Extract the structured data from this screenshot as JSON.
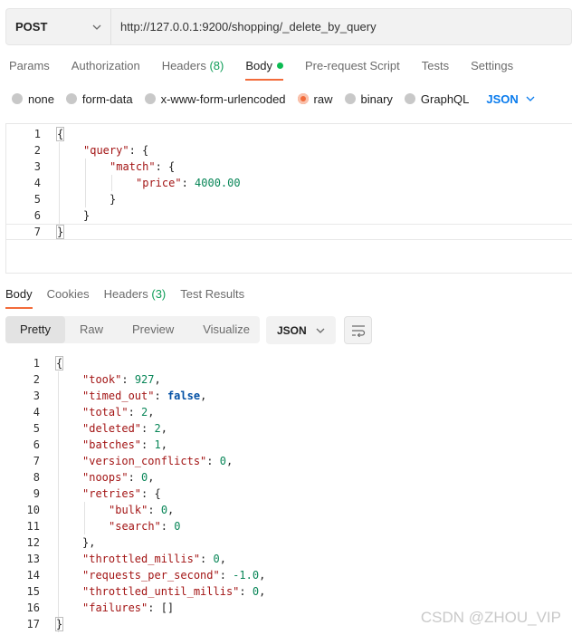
{
  "request": {
    "method": "POST",
    "url": "http://127.0.0.1:9200/shopping/_delete_by_query"
  },
  "request_tabs": {
    "params": "Params",
    "authorization": "Authorization",
    "headers": "Headers",
    "headers_count": "(8)",
    "body": "Body",
    "prerequest": "Pre-request Script",
    "tests": "Tests",
    "settings": "Settings"
  },
  "body_types": {
    "none": "none",
    "form_data": "form-data",
    "urlencoded": "x-www-form-urlencoded",
    "raw": "raw",
    "binary": "binary",
    "graphql": "GraphQL",
    "format": "JSON",
    "selected": "raw"
  },
  "request_body": {
    "line_numbers": [
      "1",
      "2",
      "3",
      "4",
      "5",
      "6",
      "7"
    ],
    "lines": {
      "l1": "{",
      "l2_key": "\"query\"",
      "l2_rest": ": {",
      "l3_key": "\"match\"",
      "l3_rest": ": {",
      "l4_key": "\"price\"",
      "l4_sep": ": ",
      "l4_val": "4000.00",
      "l5": "}",
      "l6": "}",
      "l7": "}"
    }
  },
  "response_tabs": {
    "body": "Body",
    "cookies": "Cookies",
    "headers": "Headers",
    "headers_count": "(3)",
    "test_results": "Test Results"
  },
  "response_toolbar": {
    "pretty": "Pretty",
    "raw": "Raw",
    "preview": "Preview",
    "visualize": "Visualize",
    "format": "JSON"
  },
  "response_body": {
    "line_numbers": [
      "1",
      "2",
      "3",
      "4",
      "5",
      "6",
      "7",
      "8",
      "9",
      "10",
      "11",
      "12",
      "13",
      "14",
      "15",
      "16",
      "17"
    ],
    "lines": {
      "l1": "{",
      "took_k": "\"took\"",
      "took_v": "927",
      "timed_out_k": "\"timed_out\"",
      "timed_out_v": "false",
      "total_k": "\"total\"",
      "total_v": "2",
      "deleted_k": "\"deleted\"",
      "deleted_v": "2",
      "batches_k": "\"batches\"",
      "batches_v": "1",
      "version_conflicts_k": "\"version_conflicts\"",
      "version_conflicts_v": "0",
      "noops_k": "\"noops\"",
      "noops_v": "0",
      "retries_k": "\"retries\"",
      "bulk_k": "\"bulk\"",
      "bulk_v": "0",
      "search_k": "\"search\"",
      "search_v": "0",
      "retries_close": "},",
      "throttled_millis_k": "\"throttled_millis\"",
      "throttled_millis_v": "0",
      "rps_k": "\"requests_per_second\"",
      "rps_v": "-1.0",
      "throttled_until_k": "\"throttled_until_millis\"",
      "throttled_until_v": "0",
      "failures_k": "\"failures\"",
      "failures_v": "[]",
      "l17": "}"
    }
  },
  "watermark": "CSDN @ZHOU_VIP",
  "colors": {
    "accent": "#f26b3a",
    "json_link": "#097bed",
    "key": "#a31515",
    "number": "#098658",
    "boolean": "#0451a5",
    "count_green": "#0f9d58"
  },
  "icons": [
    "chevron-down-icon",
    "radio-icon",
    "status-dot-icon",
    "wrap-lines-icon"
  ]
}
